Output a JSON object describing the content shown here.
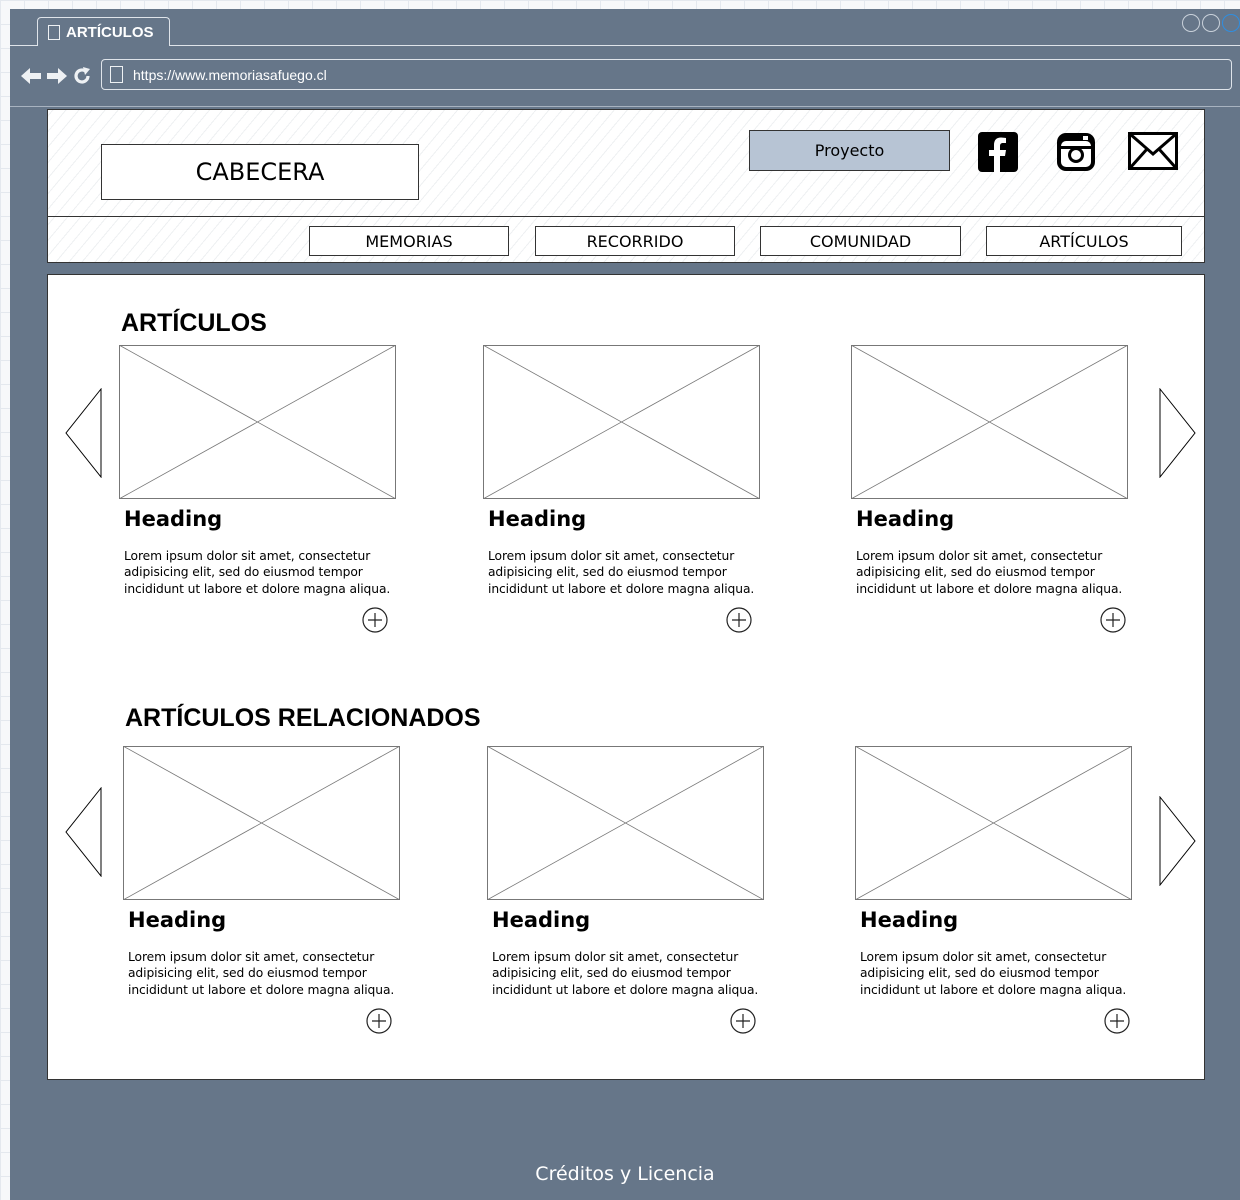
{
  "browser": {
    "tab_title": "ARTÍCULOS",
    "url": "https://www.memoriasafuego.cl"
  },
  "header": {
    "cabecera_label": "CABECERA",
    "project_button": "Proyecto",
    "social_icons": [
      "facebook-icon",
      "instagram-icon",
      "mail-icon"
    ],
    "nav": [
      "MEMORIAS",
      "RECORRIDO",
      "COMUNIDAD",
      "ARTÍCULOS"
    ]
  },
  "sections": [
    {
      "title": "ARTÍCULOS",
      "cards": [
        {
          "heading": "Heading",
          "body": "Lorem ipsum dolor sit amet, consectetur adipisicing elit, sed do eiusmod tempor incididunt ut labore et dolore magna aliqua."
        },
        {
          "heading": "Heading",
          "body": "Lorem ipsum dolor sit amet, consectetur adipisicing elit, sed do eiusmod tempor incididunt ut labore et dolore magna aliqua."
        },
        {
          "heading": "Heading",
          "body": "Lorem ipsum dolor sit amet, consectetur adipisicing elit, sed do eiusmod tempor incididunt ut labore et dolore magna aliqua."
        }
      ]
    },
    {
      "title": "ARTÍCULOS RELACIONADOS",
      "cards": [
        {
          "heading": "Heading",
          "body": "Lorem ipsum dolor sit amet, consectetur adipisicing elit, sed do eiusmod tempor incididunt ut labore et dolore magna aliqua."
        },
        {
          "heading": "Heading",
          "body": "Lorem ipsum dolor sit amet, consectetur adipisicing elit, sed do eiusmod tempor incididunt ut labore et dolore magna aliqua."
        },
        {
          "heading": "Heading",
          "body": "Lorem ipsum dolor sit amet, consectetur adipisicing elit, sed do eiusmod tempor incididunt ut labore et dolore magna aliqua."
        }
      ]
    }
  ],
  "footer": {
    "text": "Créditos y Licencia"
  },
  "colors": {
    "browser_chrome": "#667689",
    "project_button": "#b7c4d4",
    "window_control_accent": "#2f8ee0"
  }
}
